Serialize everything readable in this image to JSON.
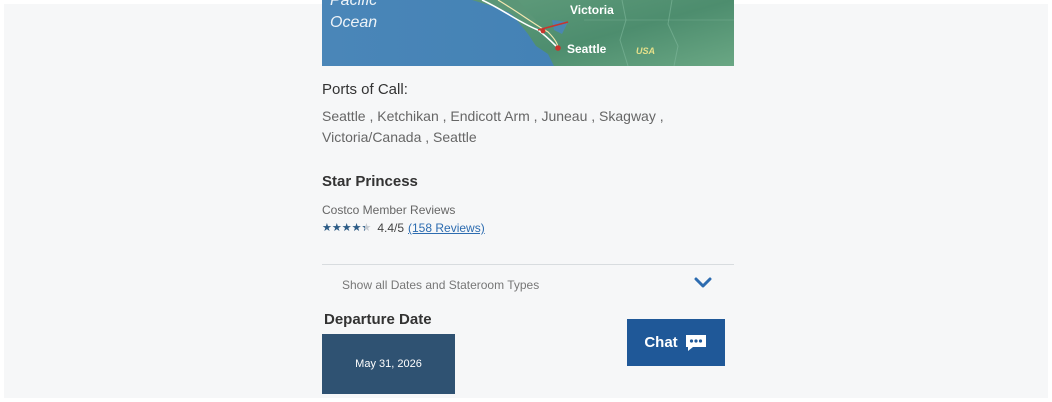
{
  "map": {
    "ocean_line1": "Pacific",
    "ocean_line2": "Ocean",
    "city_victoria": "Victoria",
    "city_seattle": "Seattle",
    "country": "USA"
  },
  "ports": {
    "heading": "Ports of Call:",
    "list": "Seattle , Ketchikan , Endicott Arm , Juneau , Skagway , Victoria/Canada , Seattle"
  },
  "ship": {
    "name": "Star Princess",
    "reviews_label": "Costco Member Reviews",
    "rating": 4.4,
    "rating_max": 5,
    "rating_text": "4.4/5",
    "reviews_link": "(158 Reviews)"
  },
  "dates_toggle": {
    "label": "Show all Dates and Stateroom Types",
    "icon": "chevron-down-icon"
  },
  "departure": {
    "heading": "Departure Date",
    "dates": [
      "May 31, 2026"
    ]
  },
  "chat": {
    "label": "Chat",
    "icon": "chat-bubble-icon"
  },
  "colors": {
    "accent": "#1f5898",
    "date_tile": "#2f5272",
    "link": "#2d6cb0",
    "star": "#2b5b86",
    "page_background": "#f6f7f8"
  }
}
